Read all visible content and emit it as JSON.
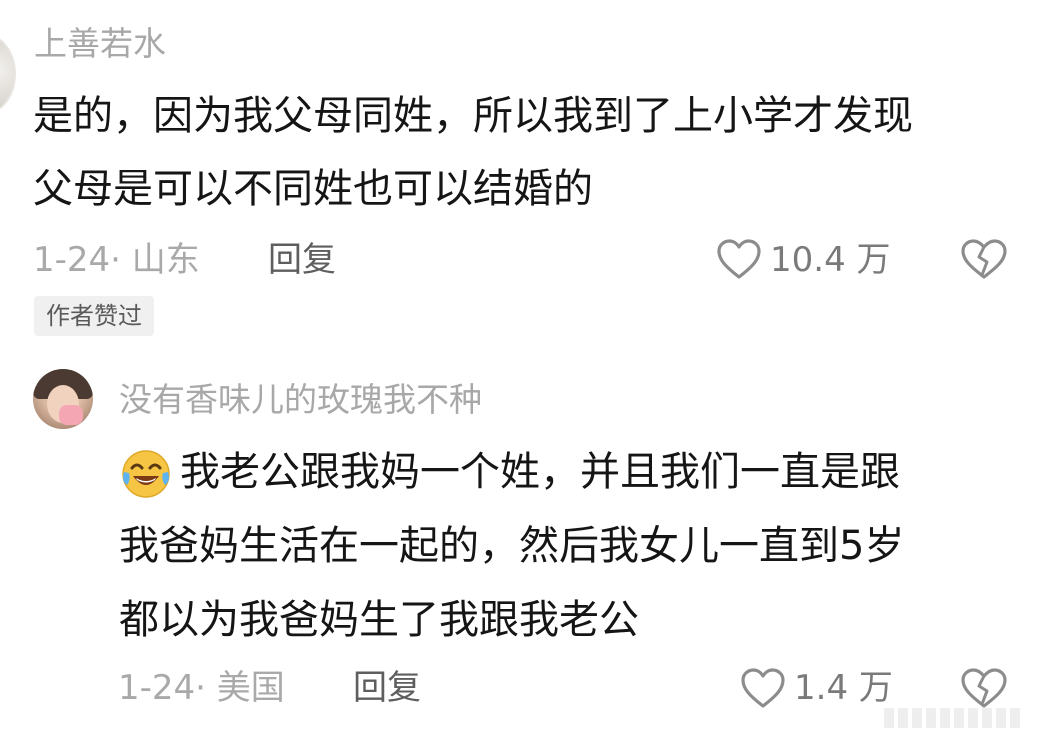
{
  "comments": [
    {
      "username": "上善若水",
      "content_lines": [
        "是的，因为我父母同姓，所以我到了上小学才发现",
        "父母是可以不同姓也可以结婚的"
      ],
      "date_location": "1-24· 山东",
      "reply_label": "回复",
      "like_count": "10.4 万",
      "badge": "作者赞过",
      "icons": {
        "like": "heart-outline-icon",
        "dislike": "broken-heart-icon"
      }
    },
    {
      "username": "没有香味儿的玫瑰我不种",
      "content_lines": [
        "我老公跟我妈一个姓，并且我们一直是跟",
        "我爸妈生活在一起的，然后我女儿一直到5岁",
        "都以为我爸妈生了我跟我老公"
      ],
      "date_location": "1-24· 美国",
      "reply_label": "回复",
      "like_count": "1.4 万",
      "icons": {
        "emoji": "laughing-tears-emoji-icon",
        "like": "heart-outline-icon",
        "dislike": "broken-heart-icon"
      }
    }
  ],
  "colors": {
    "username": "#a8a8a8",
    "content": "#151515",
    "meta": "#a9a9a9",
    "reply": "#5e5e5e",
    "icon": "#8c8c8c",
    "badge_bg": "#f0f0f0"
  }
}
